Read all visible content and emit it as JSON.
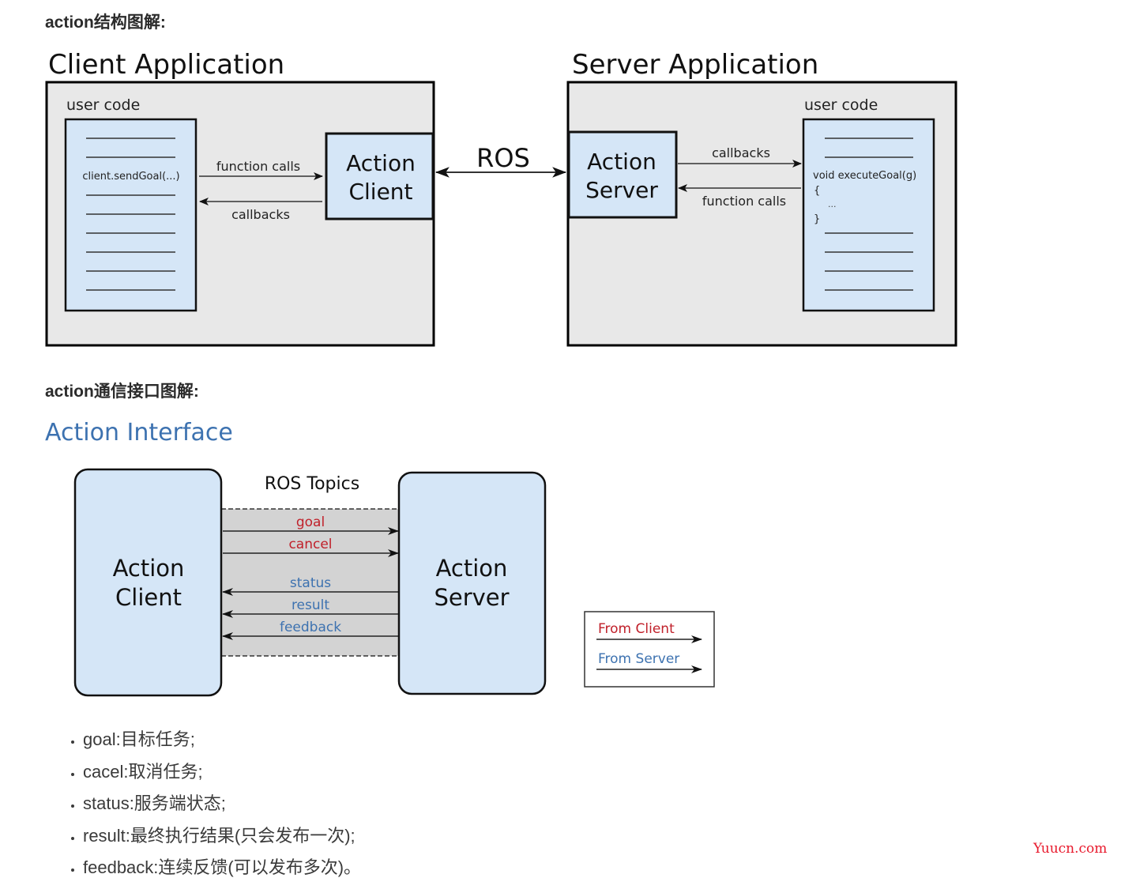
{
  "headings": {
    "structure": "action结构图解:",
    "interface": "action通信接口图解:"
  },
  "structure_diagram": {
    "client_app": {
      "title": "Client Application",
      "user_code_label": "user code",
      "code_line": "client.sendGoal(...)",
      "component": [
        "Action",
        "Client"
      ],
      "arrow_to_component": "function calls",
      "arrow_from_component": "callbacks"
    },
    "link_label": "ROS",
    "server_app": {
      "title": "Server Application",
      "user_code_label": "user code",
      "code_lines": [
        "void executeGoal(g)",
        "{",
        "...",
        "}"
      ],
      "component": [
        "Action",
        "Server"
      ],
      "arrow_to_user_code": "callbacks",
      "arrow_from_user_code": "function calls"
    },
    "colors": {
      "app_bg": "#e8e8e8",
      "box_fill": "#d5e6f7",
      "stroke": "#000000"
    }
  },
  "interface_diagram": {
    "title": "Action Interface",
    "client": [
      "Action",
      "Client"
    ],
    "server": [
      "Action",
      "Server"
    ],
    "topics_label": "ROS Topics",
    "topics": [
      {
        "name": "goal",
        "direction": "to_server",
        "color": "#c0202a"
      },
      {
        "name": "cancel",
        "direction": "to_server",
        "color": "#c0202a"
      },
      {
        "name": "status",
        "direction": "to_client",
        "color": "#3d72b0"
      },
      {
        "name": "result",
        "direction": "to_client",
        "color": "#3d72b0"
      },
      {
        "name": "feedback",
        "direction": "to_client",
        "color": "#3d72b0"
      }
    ],
    "legend": [
      {
        "label": "From Client",
        "color": "#c0202a"
      },
      {
        "label": "From Server",
        "color": "#3d72b0"
      }
    ],
    "colors": {
      "title": "#3d72b0",
      "box_fill": "#d5e6f7",
      "channel_fill": "#d3d3d3"
    }
  },
  "notes": [
    "goal:目标任务;",
    "cacel:取消任务;",
    "status:服务端状态;",
    "result:最终执行结果(只会发布一次);",
    "feedback:连续反馈(可以发布多次)。"
  ],
  "watermark": "Yuucn.com"
}
